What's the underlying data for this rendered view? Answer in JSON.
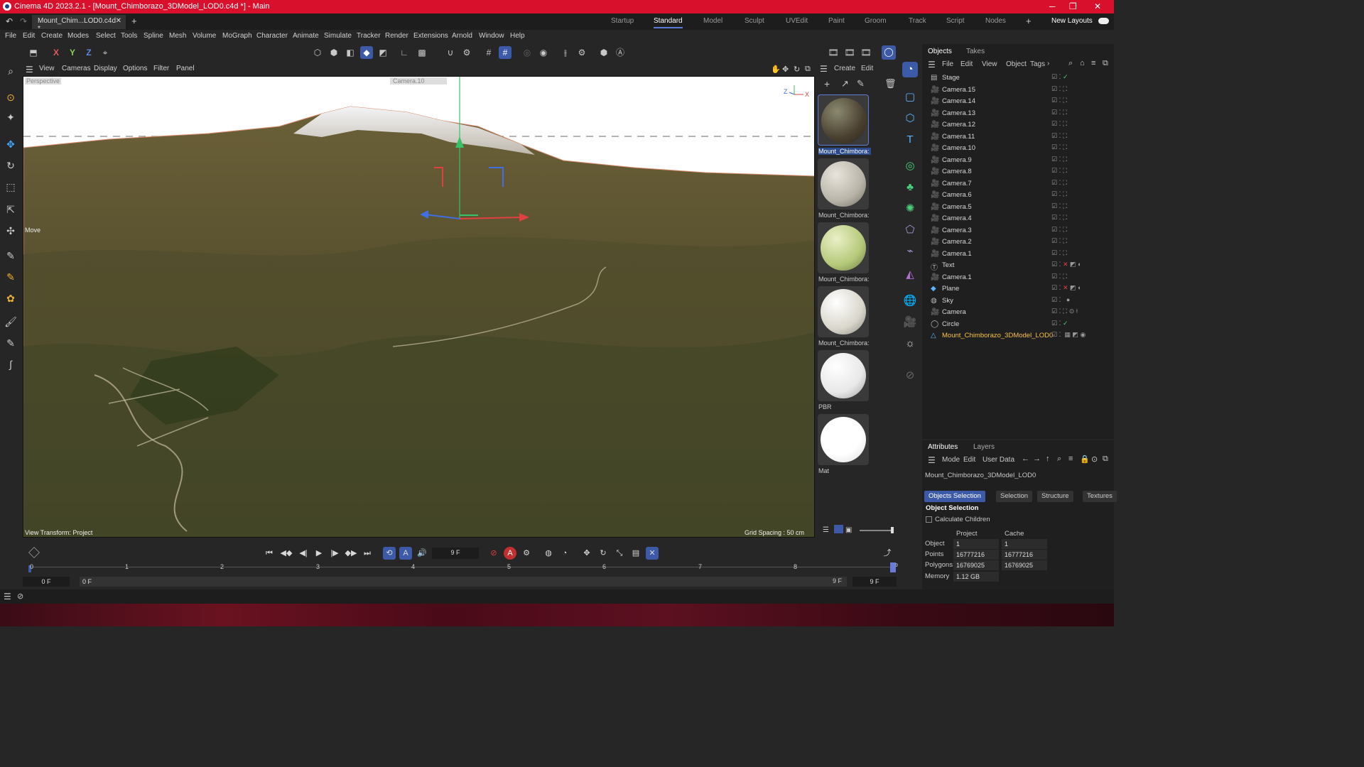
{
  "app": {
    "window_title": "Cinema 4D 2023.2.1 - [Mount_Chimborazo_3DModel_LOD0.c4d *] - Main",
    "doc_tab": "Mount_Chim...LOD0.c4d *",
    "layouts": [
      "Startup",
      "Standard",
      "Model",
      "Sculpt",
      "UVEdit",
      "Paint",
      "Groom",
      "Track",
      "Script",
      "Nodes"
    ],
    "active_layout": "Standard",
    "new_layouts": "New Layouts"
  },
  "menu": [
    "File",
    "Edit",
    "Create",
    "Modes",
    "Select",
    "Tools",
    "Spline",
    "Mesh",
    "Volume",
    "MoGraph",
    "Character",
    "Animate",
    "Simulate",
    "Tracker",
    "Render",
    "Extensions",
    "Arnold",
    "Window",
    "Help"
  ],
  "axis_toggles": [
    "X",
    "Y",
    "Z"
  ],
  "viewport": {
    "menu": [
      "View",
      "Cameras",
      "Display",
      "Options",
      "Filter",
      "Panel"
    ],
    "projection": "Perspective",
    "camera": "Camera.10",
    "tool": "Move",
    "view_transform": "View Transform: Project",
    "grid_spacing": "Grid Spacing : 50 cm"
  },
  "material_manager": {
    "menu": [
      "Create",
      "Edit"
    ],
    "materials": [
      {
        "name": "Mount_Chimbora:",
        "color": "#4a4030",
        "selected": true
      },
      {
        "name": "Mount_Chimbora:",
        "color": "#b8b4a8",
        "selected": false
      },
      {
        "name": "Mount_Chimbora:",
        "color": "#b5c97a",
        "selected": false
      },
      {
        "name": "Mount_Chimbora:",
        "color": "#d9d6cc",
        "selected": false
      },
      {
        "name": "PBR",
        "color": "#e8e8e8",
        "selected": false
      },
      {
        "name": "Mat",
        "color": "#ffffff",
        "selected": false
      }
    ]
  },
  "objects_panel": {
    "tabs": [
      "Objects",
      "Takes"
    ],
    "menu": [
      "File",
      "Edit",
      "View",
      "Object",
      "Tags"
    ],
    "items": [
      {
        "name": "Stage",
        "icon": "stage-icon"
      },
      {
        "name": "Camera.15",
        "icon": "camera-icon"
      },
      {
        "name": "Camera.14",
        "icon": "camera-icon"
      },
      {
        "name": "Camera.13",
        "icon": "camera-icon"
      },
      {
        "name": "Camera.12",
        "icon": "camera-icon"
      },
      {
        "name": "Camera.11",
        "icon": "camera-icon"
      },
      {
        "name": "Camera.10",
        "icon": "camera-icon"
      },
      {
        "name": "Camera.9",
        "icon": "camera-icon"
      },
      {
        "name": "Camera.8",
        "icon": "camera-icon"
      },
      {
        "name": "Camera.7",
        "icon": "camera-icon"
      },
      {
        "name": "Camera.6",
        "icon": "camera-icon"
      },
      {
        "name": "Camera.5",
        "icon": "camera-icon"
      },
      {
        "name": "Camera.4",
        "icon": "camera-icon"
      },
      {
        "name": "Camera.3",
        "icon": "camera-icon"
      },
      {
        "name": "Camera.2",
        "icon": "camera-icon"
      },
      {
        "name": "Camera.1",
        "icon": "camera-icon"
      },
      {
        "name": "Text",
        "icon": "text-icon"
      },
      {
        "name": "Camera.1",
        "icon": "camera-icon"
      },
      {
        "name": "Plane",
        "icon": "plane-icon"
      },
      {
        "name": "Sky",
        "icon": "sky-icon"
      },
      {
        "name": "Camera",
        "icon": "camera-icon"
      },
      {
        "name": "Circle",
        "icon": "circle-icon"
      },
      {
        "name": "Mount_Chimborazo_3DModel_LOD0",
        "icon": "polygon-icon",
        "selected": true
      }
    ]
  },
  "attributes": {
    "tabs": [
      "Attributes",
      "Layers"
    ],
    "menu": [
      "Mode",
      "Edit",
      "User Data"
    ],
    "object_name": "Mount_Chimborazo_3DModel_LOD0",
    "sub_tabs": [
      "Objects Selection",
      "Selection",
      "Structure",
      "Textures"
    ],
    "section": "Object Selection",
    "calculate_children": "Calculate Children",
    "columns": [
      "Project",
      "Cache"
    ],
    "rows": [
      {
        "label": "Object",
        "project": "1",
        "cache": "1"
      },
      {
        "label": "Points",
        "project": "16777216",
        "cache": "16777216"
      },
      {
        "label": "Polygons",
        "project": "16769025",
        "cache": "16769025"
      },
      {
        "label": "Memory",
        "project": "1.12 GB",
        "cache": ""
      }
    ]
  },
  "timeline": {
    "current_frame": "9 F",
    "start": "0 F",
    "range_start": "0 F",
    "range_end": "9 F",
    "end": "9 F",
    "ticks": [
      "0",
      "1",
      "2",
      "3",
      "4",
      "5",
      "6",
      "7",
      "8",
      "9"
    ]
  },
  "colors": {
    "titlebar": "#d9102b",
    "accent": "#3c5aa8",
    "selected_object": "#f6c343"
  }
}
